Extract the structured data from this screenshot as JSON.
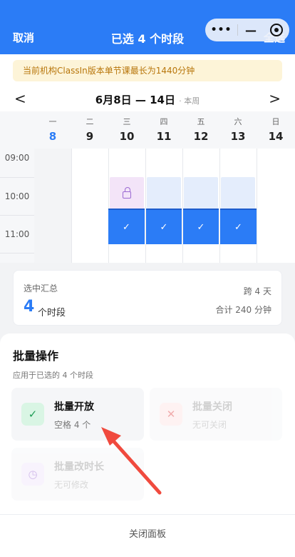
{
  "header": {
    "cancel_label": "取消",
    "title": "已选 4 个时段",
    "select_all_label": "全选",
    "capsule_more": "•••",
    "capsule_minimize": "—"
  },
  "notice": "当前机构ClassIn版本单节课最长为1440分钟",
  "week_nav": {
    "prev": "<",
    "next": ">",
    "range": "6月8日 — 14日",
    "this_week": "· 本周"
  },
  "days": [
    {
      "weekday": "一",
      "date": "8",
      "today": true
    },
    {
      "weekday": "二",
      "date": "9",
      "today": false
    },
    {
      "weekday": "三",
      "date": "10",
      "today": false
    },
    {
      "weekday": "四",
      "date": "11",
      "today": false
    },
    {
      "weekday": "五",
      "date": "12",
      "today": false
    },
    {
      "weekday": "六",
      "date": "13",
      "today": false
    },
    {
      "weekday": "日",
      "date": "14",
      "today": false
    }
  ],
  "times": [
    "09:00",
    "10:00",
    "11:00"
  ],
  "selected_mark": "✓",
  "summary": {
    "label": "选中汇总",
    "count": "4",
    "unit": "个时段",
    "span": "跨 4 天",
    "total": "合计 240 分钟"
  },
  "panel": {
    "title": "批量操作",
    "subtitle": "应用于已选的 4 个时段",
    "open": {
      "title": "批量开放",
      "sub": "空格 4 个",
      "icon": "✓"
    },
    "close": {
      "title": "批量关闭",
      "sub": "无可关闭",
      "icon": "✕"
    },
    "duration": {
      "title": "批量改时长",
      "sub": "无可修改",
      "icon": "◷"
    },
    "close_panel_label": "关闭面板"
  },
  "colors": {
    "accent": "#2b7cf6",
    "notice_bg": "#fdf4d8",
    "notice_text": "#b8760b",
    "open_icon_bg": "#d9f5e4",
    "open_icon": "#1f9d55",
    "arrow": "#f04a3e"
  }
}
